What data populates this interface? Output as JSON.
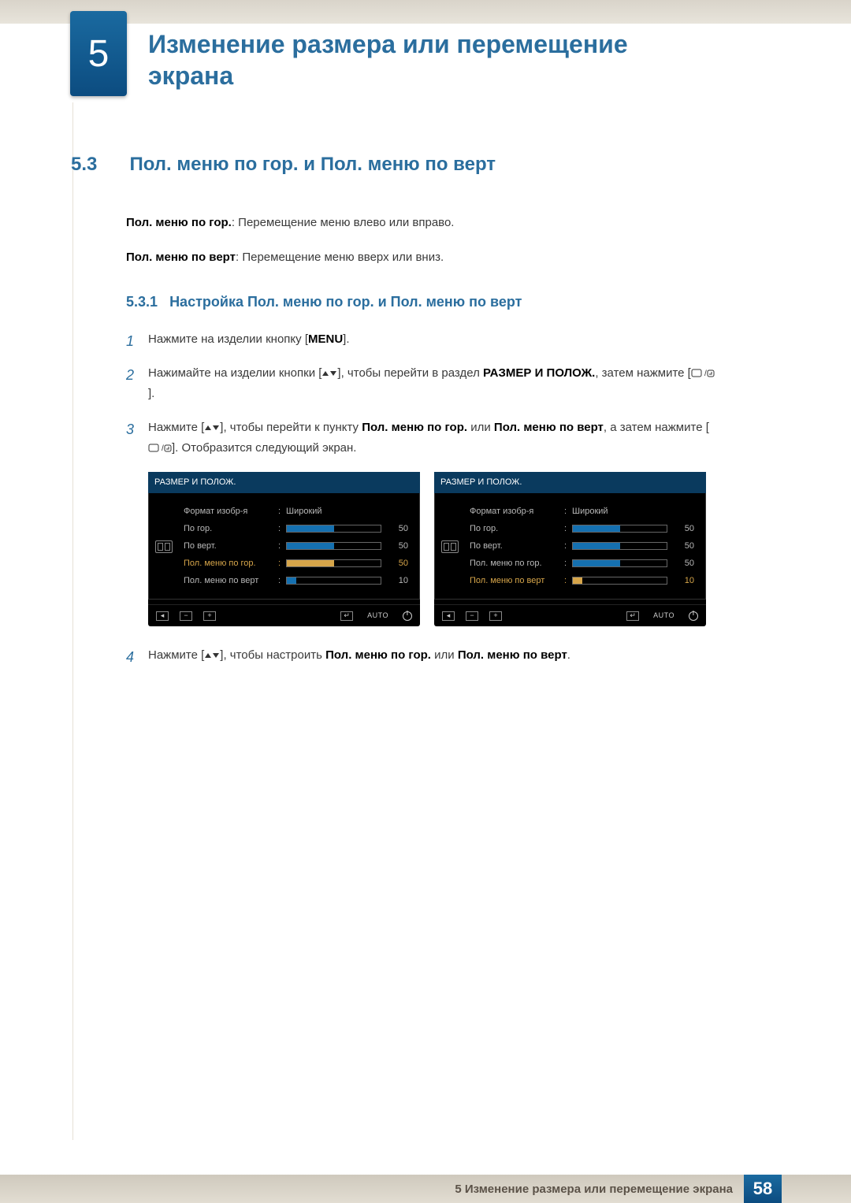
{
  "chapter": {
    "number": "5",
    "title_line1": "Изменение размера или перемещение",
    "title_line2": "экрана"
  },
  "section": {
    "number": "5.3",
    "title": "Пол. меню по гор. и Пол. меню по верт"
  },
  "intro": {
    "p1_bold": "Пол. меню по гор.",
    "p1_rest": ": Перемещение меню влево или вправо.",
    "p2_bold": "Пол. меню по верт",
    "p2_rest": ": Перемещение меню вверх или вниз."
  },
  "subsection": {
    "number": "5.3.1",
    "title": "Настройка Пол. меню по гор. и Пол. меню по верт"
  },
  "steps": {
    "s1_a": "Нажмите на изделии кнопку [",
    "s1_menu": "MENU",
    "s1_b": "].",
    "s2_a": "Нажимайте на изделии кнопки [",
    "s2_b": "], чтобы перейти в раздел ",
    "s2_bold": "РАЗМЕР И ПОЛОЖ.",
    "s2_c": ", затем нажмите [",
    "s2_d": "].",
    "s3_a": "Нажмите [",
    "s3_b": "], чтобы перейти к пункту ",
    "s3_bold1": "Пол. меню по гор.",
    "s3_or": " или ",
    "s3_bold2": "Пол. меню по верт",
    "s3_c": ", а затем нажмите [",
    "s3_d": "]. Отобразится следующий экран.",
    "s4_a": "Нажмите [",
    "s4_b": "], чтобы настроить ",
    "s4_bold1": "Пол. меню по гор.",
    "s4_or": " или ",
    "s4_bold2": "Пол. меню по верт",
    "s4_c": "."
  },
  "osd": {
    "header": "РАЗМЕР И ПОЛОЖ.",
    "rows": {
      "r1_label": "Формат изобр-я",
      "r1_val": "Широкий",
      "r2_label": "По гор.",
      "r2_num": "50",
      "r3_label": "По верт.",
      "r3_num": "50",
      "r4_label": "Пол. меню по гор.",
      "r4_num": "50",
      "r5_label": "Пол. меню по верт",
      "r5_num": "10"
    },
    "footer": {
      "auto": "AUTO"
    }
  },
  "footer": {
    "text": "5 Изменение размера или перемещение экрана",
    "page": "58"
  }
}
